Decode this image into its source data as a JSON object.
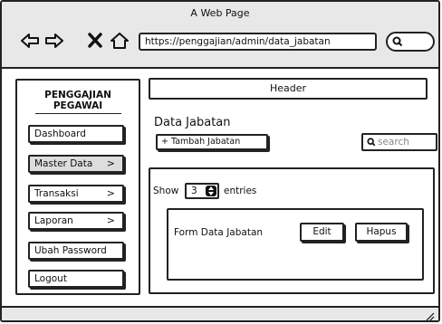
{
  "window": {
    "title": "A Web Page",
    "url": "https://penggajian/admin/data_jabatan"
  },
  "sidebar": {
    "brand_line1": "PENGGAJIAN",
    "brand_line2": "PEGAWAI",
    "items": [
      {
        "label": "Dashboard",
        "chevron": ""
      },
      {
        "label": "Master Data",
        "chevron": ">"
      },
      {
        "label": "Transaksi",
        "chevron": ">"
      },
      {
        "label": "Laporan",
        "chevron": ">"
      },
      {
        "label": "Ubah Password",
        "chevron": ""
      },
      {
        "label": "Logout",
        "chevron": ""
      }
    ]
  },
  "header": {
    "label": "Header"
  },
  "main": {
    "title": "Data Jabatan",
    "add_button": "+ Tambah Jabatan",
    "search_placeholder": "search",
    "show_label": "Show",
    "entries_value": "3",
    "entries_label": "entries",
    "form_label": "Form Data Jabatan",
    "edit_button": "Edit",
    "delete_button": "Hapus"
  },
  "icons": {
    "back": "back-arrow-icon",
    "forward": "forward-arrow-icon",
    "close": "close-icon",
    "home": "home-icon",
    "search": "search-icon"
  }
}
